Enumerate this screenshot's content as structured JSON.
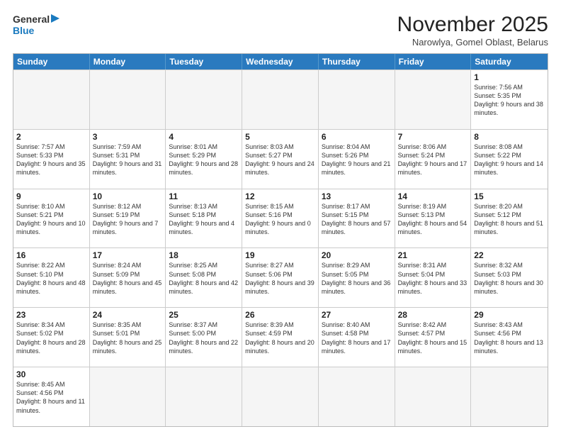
{
  "header": {
    "logo_general": "General",
    "logo_blue": "Blue",
    "month_title": "November 2025",
    "location": "Narowlya, Gomel Oblast, Belarus"
  },
  "weekdays": [
    "Sunday",
    "Monday",
    "Tuesday",
    "Wednesday",
    "Thursday",
    "Friday",
    "Saturday"
  ],
  "rows": [
    [
      {
        "day": "",
        "info": ""
      },
      {
        "day": "",
        "info": ""
      },
      {
        "day": "",
        "info": ""
      },
      {
        "day": "",
        "info": ""
      },
      {
        "day": "",
        "info": ""
      },
      {
        "day": "",
        "info": ""
      },
      {
        "day": "1",
        "info": "Sunrise: 7:56 AM\nSunset: 5:35 PM\nDaylight: 9 hours and 38 minutes."
      }
    ],
    [
      {
        "day": "2",
        "info": "Sunrise: 7:57 AM\nSunset: 5:33 PM\nDaylight: 9 hours and 35 minutes."
      },
      {
        "day": "3",
        "info": "Sunrise: 7:59 AM\nSunset: 5:31 PM\nDaylight: 9 hours and 31 minutes."
      },
      {
        "day": "4",
        "info": "Sunrise: 8:01 AM\nSunset: 5:29 PM\nDaylight: 9 hours and 28 minutes."
      },
      {
        "day": "5",
        "info": "Sunrise: 8:03 AM\nSunset: 5:27 PM\nDaylight: 9 hours and 24 minutes."
      },
      {
        "day": "6",
        "info": "Sunrise: 8:04 AM\nSunset: 5:26 PM\nDaylight: 9 hours and 21 minutes."
      },
      {
        "day": "7",
        "info": "Sunrise: 8:06 AM\nSunset: 5:24 PM\nDaylight: 9 hours and 17 minutes."
      },
      {
        "day": "8",
        "info": "Sunrise: 8:08 AM\nSunset: 5:22 PM\nDaylight: 9 hours and 14 minutes."
      }
    ],
    [
      {
        "day": "9",
        "info": "Sunrise: 8:10 AM\nSunset: 5:21 PM\nDaylight: 9 hours and 10 minutes."
      },
      {
        "day": "10",
        "info": "Sunrise: 8:12 AM\nSunset: 5:19 PM\nDaylight: 9 hours and 7 minutes."
      },
      {
        "day": "11",
        "info": "Sunrise: 8:13 AM\nSunset: 5:18 PM\nDaylight: 9 hours and 4 minutes."
      },
      {
        "day": "12",
        "info": "Sunrise: 8:15 AM\nSunset: 5:16 PM\nDaylight: 9 hours and 0 minutes."
      },
      {
        "day": "13",
        "info": "Sunrise: 8:17 AM\nSunset: 5:15 PM\nDaylight: 8 hours and 57 minutes."
      },
      {
        "day": "14",
        "info": "Sunrise: 8:19 AM\nSunset: 5:13 PM\nDaylight: 8 hours and 54 minutes."
      },
      {
        "day": "15",
        "info": "Sunrise: 8:20 AM\nSunset: 5:12 PM\nDaylight: 8 hours and 51 minutes."
      }
    ],
    [
      {
        "day": "16",
        "info": "Sunrise: 8:22 AM\nSunset: 5:10 PM\nDaylight: 8 hours and 48 minutes."
      },
      {
        "day": "17",
        "info": "Sunrise: 8:24 AM\nSunset: 5:09 PM\nDaylight: 8 hours and 45 minutes."
      },
      {
        "day": "18",
        "info": "Sunrise: 8:25 AM\nSunset: 5:08 PM\nDaylight: 8 hours and 42 minutes."
      },
      {
        "day": "19",
        "info": "Sunrise: 8:27 AM\nSunset: 5:06 PM\nDaylight: 8 hours and 39 minutes."
      },
      {
        "day": "20",
        "info": "Sunrise: 8:29 AM\nSunset: 5:05 PM\nDaylight: 8 hours and 36 minutes."
      },
      {
        "day": "21",
        "info": "Sunrise: 8:31 AM\nSunset: 5:04 PM\nDaylight: 8 hours and 33 minutes."
      },
      {
        "day": "22",
        "info": "Sunrise: 8:32 AM\nSunset: 5:03 PM\nDaylight: 8 hours and 30 minutes."
      }
    ],
    [
      {
        "day": "23",
        "info": "Sunrise: 8:34 AM\nSunset: 5:02 PM\nDaylight: 8 hours and 28 minutes."
      },
      {
        "day": "24",
        "info": "Sunrise: 8:35 AM\nSunset: 5:01 PM\nDaylight: 8 hours and 25 minutes."
      },
      {
        "day": "25",
        "info": "Sunrise: 8:37 AM\nSunset: 5:00 PM\nDaylight: 8 hours and 22 minutes."
      },
      {
        "day": "26",
        "info": "Sunrise: 8:39 AM\nSunset: 4:59 PM\nDaylight: 8 hours and 20 minutes."
      },
      {
        "day": "27",
        "info": "Sunrise: 8:40 AM\nSunset: 4:58 PM\nDaylight: 8 hours and 17 minutes."
      },
      {
        "day": "28",
        "info": "Sunrise: 8:42 AM\nSunset: 4:57 PM\nDaylight: 8 hours and 15 minutes."
      },
      {
        "day": "29",
        "info": "Sunrise: 8:43 AM\nSunset: 4:56 PM\nDaylight: 8 hours and 13 minutes."
      }
    ],
    [
      {
        "day": "30",
        "info": "Sunrise: 8:45 AM\nSunset: 4:56 PM\nDaylight: 8 hours and 11 minutes."
      },
      {
        "day": "",
        "info": ""
      },
      {
        "day": "",
        "info": ""
      },
      {
        "day": "",
        "info": ""
      },
      {
        "day": "",
        "info": ""
      },
      {
        "day": "",
        "info": ""
      },
      {
        "day": "",
        "info": ""
      }
    ]
  ]
}
